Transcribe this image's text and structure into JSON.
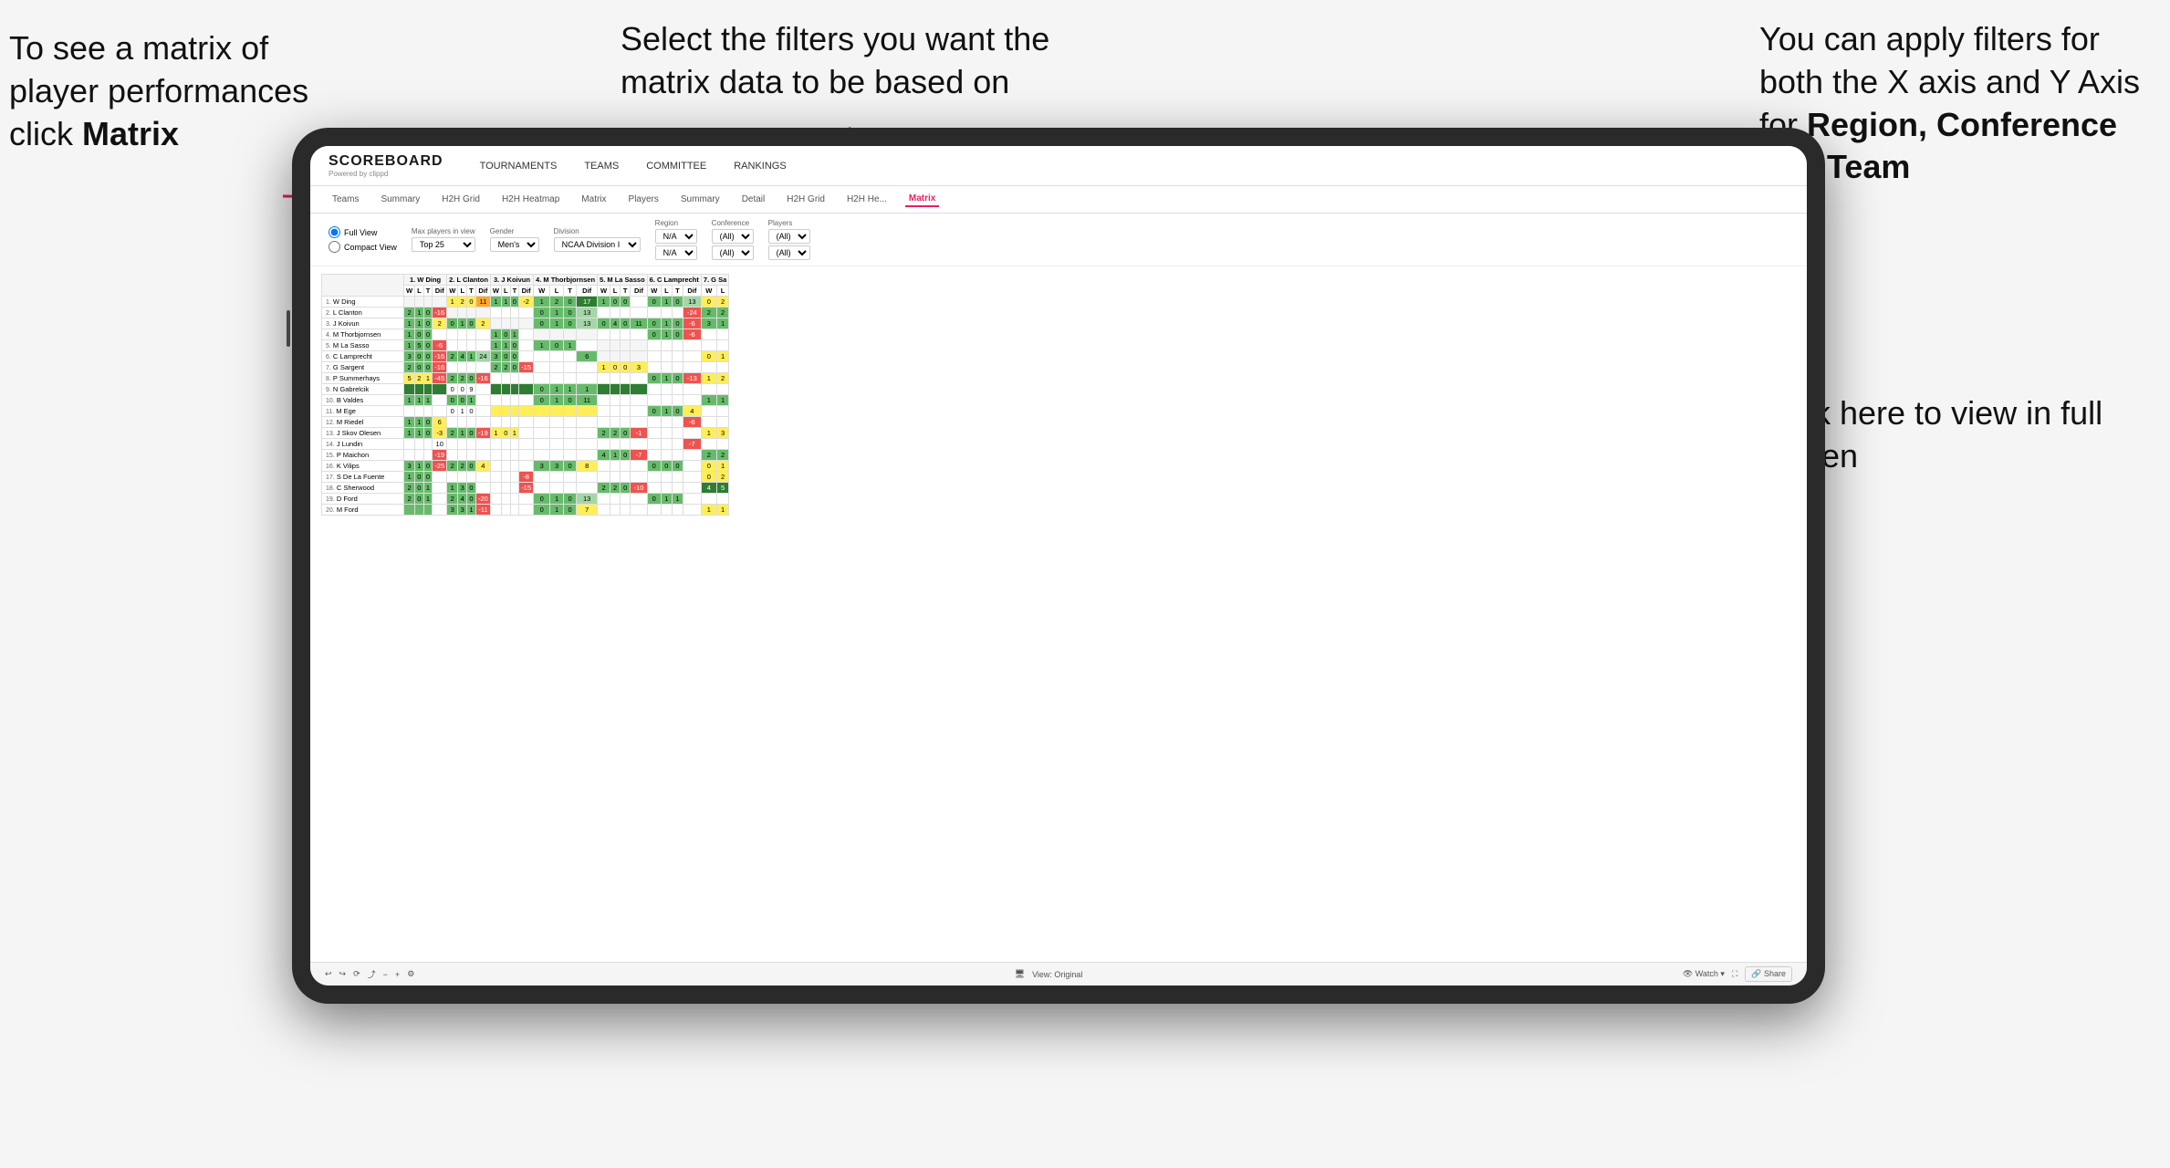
{
  "annotations": {
    "left": "To see a matrix of player performances click Matrix",
    "left_bold": "Matrix",
    "center": "Select the filters you want the matrix data to be based on",
    "right_top_line1": "You  can apply filters for both the X axis and Y Axis for ",
    "right_top_bold": "Region, Conference and Team",
    "right_bottom": "Click here to view in full screen"
  },
  "nav": {
    "logo": "SCOREBOARD",
    "logo_sub": "Powered by clippd",
    "items": [
      "TOURNAMENTS",
      "TEAMS",
      "COMMITTEE",
      "RANKINGS"
    ]
  },
  "sub_nav": {
    "items": [
      "Teams",
      "Summary",
      "H2H Grid",
      "H2H Heatmap",
      "Matrix",
      "Players",
      "Summary",
      "Detail",
      "H2H Grid",
      "H2H He...",
      "Matrix"
    ],
    "active_index": 10
  },
  "filters": {
    "view_options": [
      "Full View",
      "Compact View"
    ],
    "max_players": {
      "label": "Max players in view",
      "value": "Top 25"
    },
    "gender": {
      "label": "Gender",
      "value": "Men's"
    },
    "division": {
      "label": "Division",
      "value": "NCAA Division I"
    },
    "region": {
      "label": "Region",
      "values": [
        "N/A",
        "N/A"
      ]
    },
    "conference": {
      "label": "Conference",
      "values": [
        "(All)",
        "(All)"
      ]
    },
    "players": {
      "label": "Players",
      "values": [
        "(All)",
        "(All)"
      ]
    }
  },
  "matrix": {
    "col_headers": [
      "1. W Ding",
      "2. L Clanton",
      "3. J Koivun",
      "4. M Thorbjornsen",
      "5. M La Sasso",
      "6. C Lamprecht",
      "7. G Sa"
    ],
    "sub_headers": [
      "W",
      "L",
      "T",
      "Dif"
    ],
    "rows": [
      {
        "num": "1.",
        "name": "W Ding"
      },
      {
        "num": "2.",
        "name": "L Clanton"
      },
      {
        "num": "3.",
        "name": "J Koivun"
      },
      {
        "num": "4.",
        "name": "M Thorbjornsen"
      },
      {
        "num": "5.",
        "name": "M La Sasso"
      },
      {
        "num": "6.",
        "name": "C Lamprecht"
      },
      {
        "num": "7.",
        "name": "G Sargent"
      },
      {
        "num": "8.",
        "name": "P Summerhays"
      },
      {
        "num": "9.",
        "name": "N Gabrelcik"
      },
      {
        "num": "10.",
        "name": "B Valdes"
      },
      {
        "num": "11.",
        "name": "M Ege"
      },
      {
        "num": "12.",
        "name": "M Riedel"
      },
      {
        "num": "13.",
        "name": "J Skov Olesen"
      },
      {
        "num": "14.",
        "name": "J Lundin"
      },
      {
        "num": "15.",
        "name": "P Maichon"
      },
      {
        "num": "16.",
        "name": "K Vilips"
      },
      {
        "num": "17.",
        "name": "S De La Fuente"
      },
      {
        "num": "18.",
        "name": "C Sherwood"
      },
      {
        "num": "19.",
        "name": "D Ford"
      },
      {
        "num": "20.",
        "name": "M Ford"
      }
    ]
  },
  "toolbar": {
    "view_label": "View: Original",
    "watch_label": "Watch",
    "share_label": "Share"
  }
}
